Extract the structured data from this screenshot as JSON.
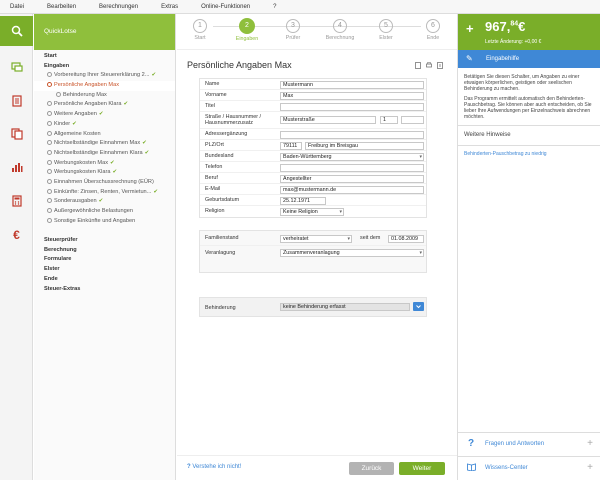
{
  "menu": [
    "Datei",
    "Bearbeiten",
    "Berechnungen",
    "Extras",
    "Online-Funktionen",
    "?"
  ],
  "sidebar": {
    "title": "QuickLotse",
    "items": [
      {
        "label": "Start",
        "bold": true,
        "indent": 0
      },
      {
        "label": "Eingaben",
        "bold": true,
        "indent": 0
      },
      {
        "label": "Vorbereitung Ihrer Steuererklärung 2...",
        "circle": true,
        "check": true,
        "indent": 1
      },
      {
        "label": "Persönliche Angaben Max",
        "circle": true,
        "active": true,
        "indent": 1
      },
      {
        "label": "Behinderung Max",
        "circle": true,
        "indent": 2
      },
      {
        "label": "Persönliche Angaben Klara",
        "circle": true,
        "check": true,
        "indent": 1
      },
      {
        "label": "Weitere Angaben",
        "circle": true,
        "check": true,
        "indent": 1
      },
      {
        "label": "Kinder",
        "circle": true,
        "check": true,
        "indent": 1
      },
      {
        "label": "Allgemeine Kosten",
        "circle": true,
        "indent": 1
      },
      {
        "label": "Nichtselbständige Einnahmen Max",
        "circle": true,
        "check": true,
        "indent": 1
      },
      {
        "label": "Nichtselbständige Einnahmen Klara",
        "circle": true,
        "check": true,
        "indent": 1
      },
      {
        "label": "Werbungskosten Max",
        "circle": true,
        "check": true,
        "indent": 1
      },
      {
        "label": "Werbungskosten Klara",
        "circle": true,
        "check": true,
        "indent": 1
      },
      {
        "label": "Einnahmen Überschussrechnung (EÜR)",
        "circle": true,
        "indent": 1
      },
      {
        "label": "Einkünfte: Zinsen, Renten, Vermietun...",
        "circle": true,
        "check": true,
        "indent": 1
      },
      {
        "label": "Sonderausgaben",
        "circle": true,
        "check": true,
        "indent": 1
      },
      {
        "label": "Außergewöhnliche Belastungen",
        "circle": true,
        "indent": 1
      },
      {
        "label": "Sonstige Einkünfte und Angaben",
        "circle": true,
        "indent": 1
      },
      {
        "label": "",
        "indent": 0
      },
      {
        "label": "Steuerprüfer",
        "bold": true,
        "indent": 0
      },
      {
        "label": "Berechnung",
        "bold": true,
        "indent": 0
      },
      {
        "label": "Formulare",
        "bold": true,
        "indent": 0
      },
      {
        "label": "Elster",
        "bold": true,
        "indent": 0
      },
      {
        "label": "Ende",
        "bold": true,
        "indent": 0
      },
      {
        "label": "Steuer-Extras",
        "bold": true,
        "indent": 0
      }
    ]
  },
  "steps": [
    {
      "num": "1",
      "label": "Start"
    },
    {
      "num": "2",
      "label": "Eingaben",
      "active": true
    },
    {
      "num": "3",
      "label": "Prüfer"
    },
    {
      "num": "4",
      "label": "Berechnung"
    },
    {
      "num": "5",
      "label": "Elster"
    },
    {
      "num": "6",
      "label": "Ende"
    }
  ],
  "page": {
    "title": "Persönliche Angaben Max"
  },
  "form": {
    "name_label": "Name",
    "name": "Mustermann",
    "vorname_label": "Vorname",
    "vorname": "Max",
    "titel_label": "Titel",
    "titel": "",
    "strasse_label": "Straße / Hausnummer / Hausnummerzusatz",
    "strasse": "Musterstraße",
    "hausnr": "1",
    "zusatz": "",
    "adresse_label": "Adressergänzung",
    "adresse": "",
    "plz_label": "PLZ/Ort",
    "plz": "79111",
    "ort": "Freiburg im Breisgau",
    "bundesland_label": "Bundesland",
    "bundesland": "Baden-Württemberg",
    "telefon_label": "Telefon",
    "telefon": "",
    "beruf_label": "Beruf",
    "beruf": "Angestellter",
    "email_label": "E-Mail",
    "email": "max@mustermann.de",
    "geburt_label": "Geburtsdatum",
    "geburt": "25.12.1971",
    "religion_label": "Religion",
    "religion": "Keine Religion",
    "familienstand_label": "Familienstand",
    "familienstand": "verheiratet",
    "seit_label": "seit dem",
    "seit": "01.08.2009",
    "veranlagung_label": "Veranlagung",
    "veranlagung": "Zusammenveranlagung",
    "behinderung_label": "Behinderung",
    "behinderung": "keine Behinderung erfasst"
  },
  "footer": {
    "help": "Verstehe ich nicht!",
    "back": "Zurück",
    "next": "Weiter"
  },
  "right": {
    "amount_main": "967,",
    "amount_cents": "84",
    "amount_currency": "€",
    "last_change": "Letzte Änderung: +0,00 €",
    "tab": "Eingabehilfe",
    "help_p1": "Betätigen Sie diesen Schalter, um Angaben zu einer etwaigen körperlichen, geistigen oder seelischen Behinderung zu machen.",
    "help_p2": "Das Programm ermittelt automatisch den Behinderten-Pauschbetrag. Sie können aber auch entscheiden, ob Sie lieber Ihre Aufwendungen per Einzelnachweis abrechnen möchten.",
    "section": "Weitere Hinweise",
    "link": "Behinderten-Pauschbetrag zu niedrig",
    "faq": "Fragen und Antworten",
    "wissen": "Wissens-Center"
  },
  "colors": {
    "accent": "#8fbf3c",
    "accent_dark": "#7aae29",
    "blue": "#3f88d6",
    "active_orange": "#c9542a"
  }
}
